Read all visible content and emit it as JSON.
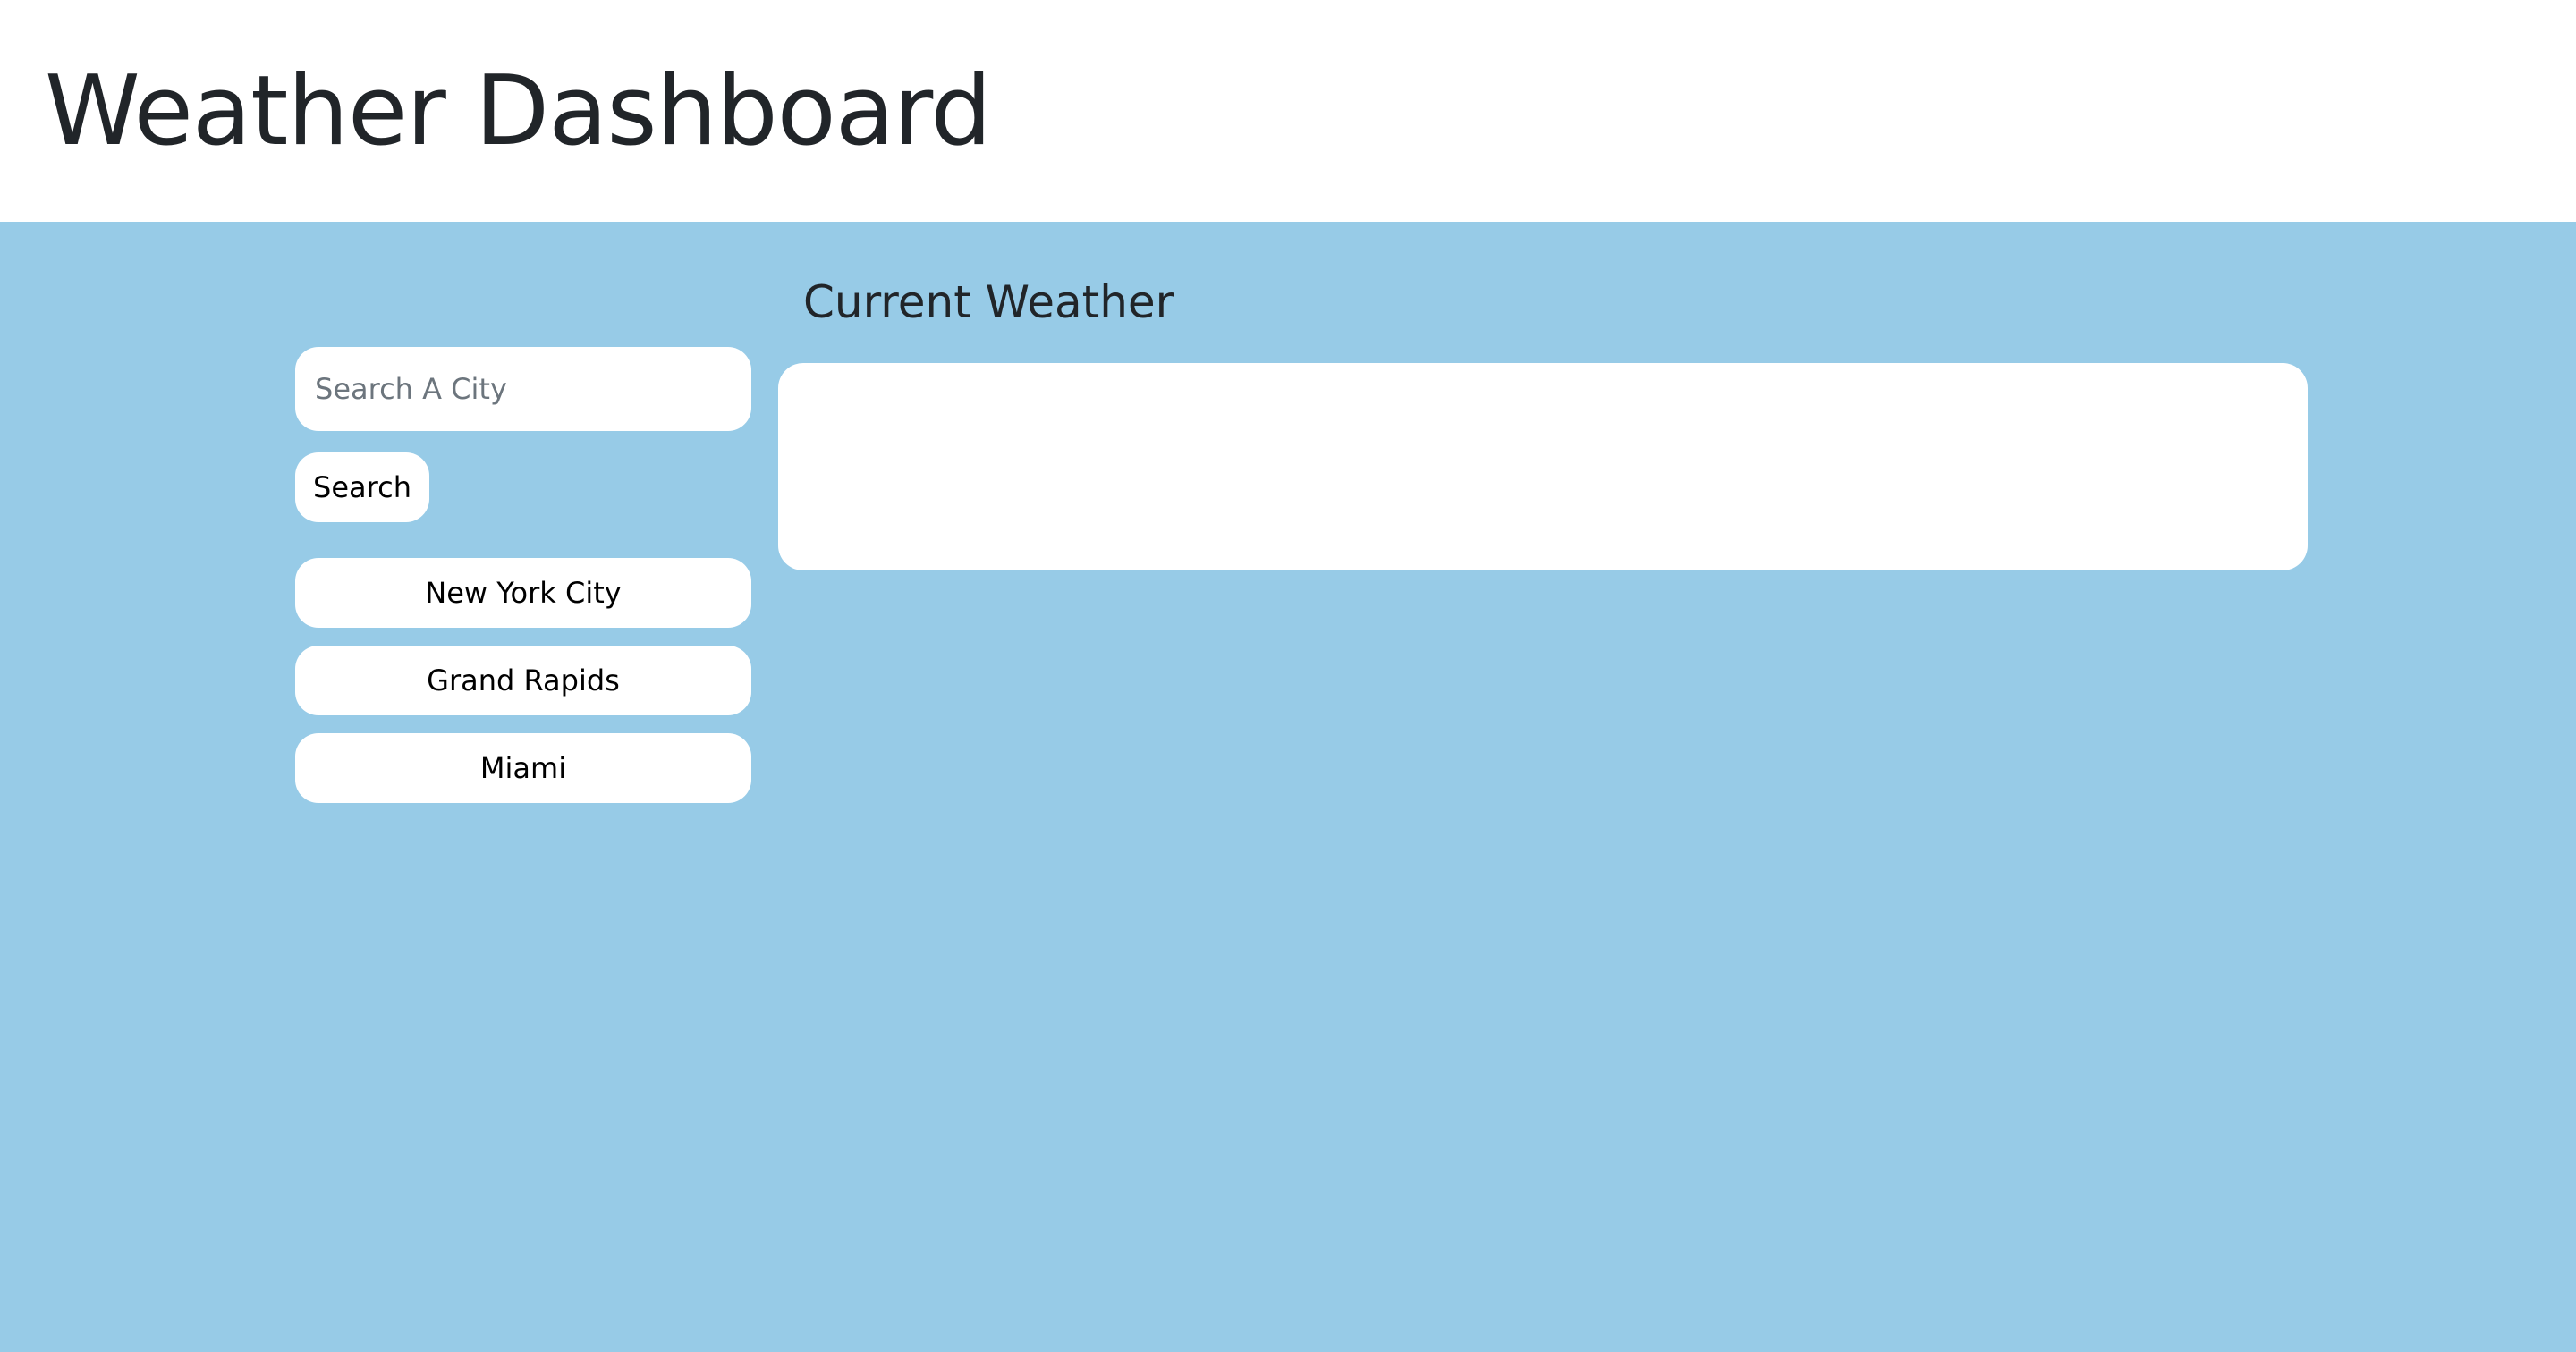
{
  "header": {
    "title": "Weather Dashboard"
  },
  "search": {
    "placeholder": "Search A City",
    "value": "",
    "button_label": "Search"
  },
  "history": [
    {
      "label": "New York City"
    },
    {
      "label": "Grand Rapids"
    },
    {
      "label": "Miami"
    }
  ],
  "current": {
    "title": "Current Weather"
  },
  "colors": {
    "background": "#97cbe7",
    "header_background": "#ffffff",
    "panel": "#ffffff",
    "text": "#212529"
  }
}
